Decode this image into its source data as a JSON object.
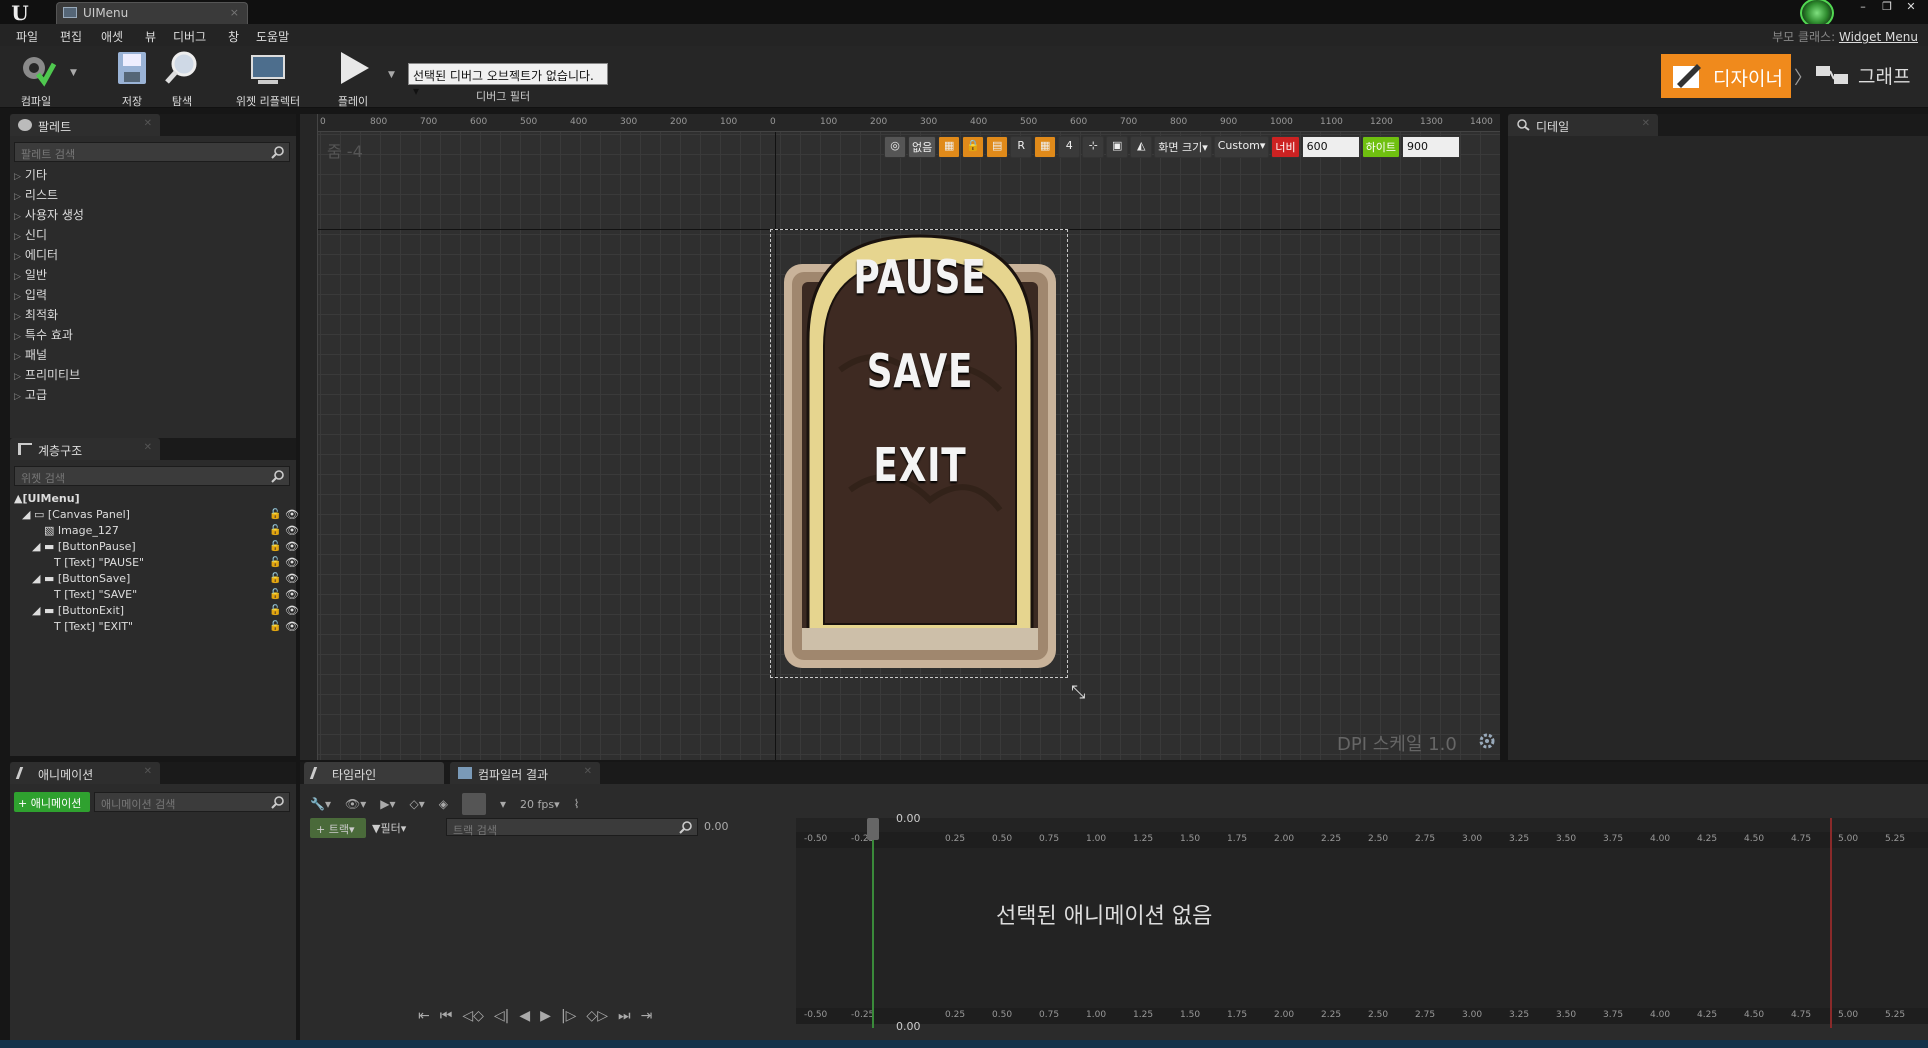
{
  "app": {
    "logo": "U",
    "tab_title": "UIMenu",
    "tab_close": "×",
    "window_controls": [
      "–",
      "❐",
      "✕"
    ]
  },
  "menu": {
    "items": [
      "파일",
      "편집",
      "애셋",
      "뷰",
      "디버그",
      "창",
      "도움말"
    ],
    "parent_class_label": "부모 클래스:",
    "parent_class_value": "Widget Menu"
  },
  "toolbar": {
    "compile": "컴파일",
    "save": "저장",
    "browse": "탐색",
    "widget_reflector": "위젯 리플렉터",
    "play": "플레이",
    "debug_select": "선택된 디버그 오브젝트가 없습니다.",
    "debug_filter": "디버그 필터",
    "designer": "디자이너",
    "graph": "그래프",
    "crumb_sep": "〉"
  },
  "palette": {
    "tab": "팔레트",
    "search_placeholder": "팔레트 검색",
    "categories": [
      "기타",
      "리스트",
      "사용자 생성",
      "신디",
      "에디터",
      "일반",
      "입력",
      "최적화",
      "특수 효과",
      "패널",
      "프리미티브",
      "고급"
    ]
  },
  "hierarchy": {
    "tab": "계층구조",
    "search_placeholder": "위젯 검색",
    "rows": [
      "▲[UIMenu]",
      "◢ ▭ [Canvas Panel]",
      "▧ Image_127",
      "◢ ▬ [ButtonPause]",
      "T [Text] \"PAUSE\"",
      "◢ ▬ [ButtonSave]",
      "T [Text] \"SAVE\"",
      "◢ ▬ [ButtonExit]",
      "T [Text] \"EXIT\""
    ]
  },
  "viewport": {
    "zoom": "줌 -4",
    "ruler_top": [
      "0",
      "800",
      "700",
      "600",
      "500",
      "400",
      "300",
      "200",
      "100",
      "0",
      "100",
      "200",
      "300",
      "400",
      "500",
      "600",
      "700",
      "800",
      "900",
      "1000",
      "1100",
      "1200",
      "1300",
      "1400"
    ],
    "controls": {
      "none": "없음",
      "r": "R",
      "four": "4",
      "screen_size": "화면 크기▾",
      "custom": "Custom▾",
      "width_label": "너비",
      "width_value": "600",
      "height_label": "하이트",
      "height_value": "900"
    },
    "dpi": "DPI 스케일 1.0",
    "buttons": [
      "PAUSE",
      "SAVE",
      "EXIT"
    ]
  },
  "details": {
    "tab": "디테일"
  },
  "animation": {
    "tab": "애니메이션",
    "add_button": "+ 애니메이션",
    "search_placeholder": "애니메이션 검색"
  },
  "timeline": {
    "tab_timeline": "타임라인",
    "tab_compiler": "컴파일러 결과",
    "fps": "20 fps▾",
    "track_button": "+ 트랙▾",
    "filter_button": "▼필터▾",
    "track_search_placeholder": "트랙 검색",
    "time_value": "0.00",
    "time_top": "0.00",
    "time_bottom": "0.00",
    "no_animation": "선택된 애니메이션 없음",
    "ticks": [
      "-0.50",
      "-0.25",
      "0.25",
      "0.50",
      "0.75",
      "1.00",
      "1.25",
      "1.50",
      "1.75",
      "2.00",
      "2.25",
      "2.50",
      "2.75",
      "3.00",
      "3.25",
      "3.50",
      "3.75",
      "4.00",
      "4.25",
      "4.50",
      "4.75",
      "5.00",
      "5.25"
    ]
  },
  "colors": {
    "accent": "#f08a1c",
    "green": "#2fa12f",
    "canvas_bg": "#2f2f2f"
  }
}
